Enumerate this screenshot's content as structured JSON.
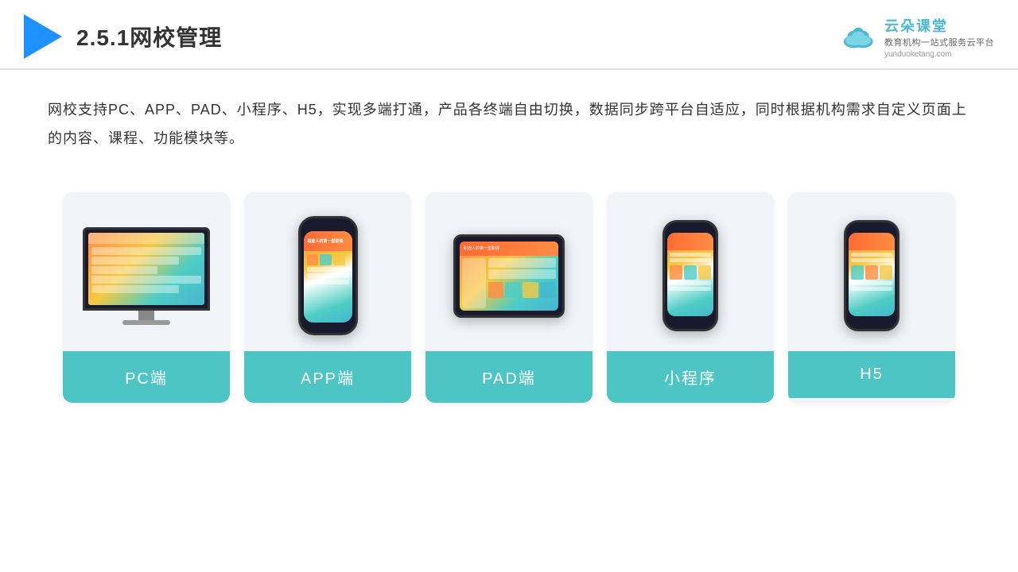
{
  "header": {
    "title": "2.5.1网校管理",
    "brand": {
      "name": "云朵课堂",
      "url": "yunduoketang.com",
      "tagline": "教育机构一站\n式服务云平台"
    }
  },
  "description": {
    "text": "网校支持PC、APP、PAD、小程序、H5，实现多端打通，产品各终端自由切换，数据同步跨平台自适应，同时根据机构需求自定义页面上的内容、课程、功能模块等。"
  },
  "cards": [
    {
      "id": "pc",
      "label": "PC端"
    },
    {
      "id": "app",
      "label": "APP端"
    },
    {
      "id": "pad",
      "label": "PAD端"
    },
    {
      "id": "miniprogram",
      "label": "小程序"
    },
    {
      "id": "h5",
      "label": "H5"
    }
  ],
  "colors": {
    "accent": "#4ec5c5",
    "triangle": "#1e90ff",
    "text": "#333333",
    "card_bg": "#f0f4f8",
    "card_label_bg": "#4ec5c5"
  }
}
